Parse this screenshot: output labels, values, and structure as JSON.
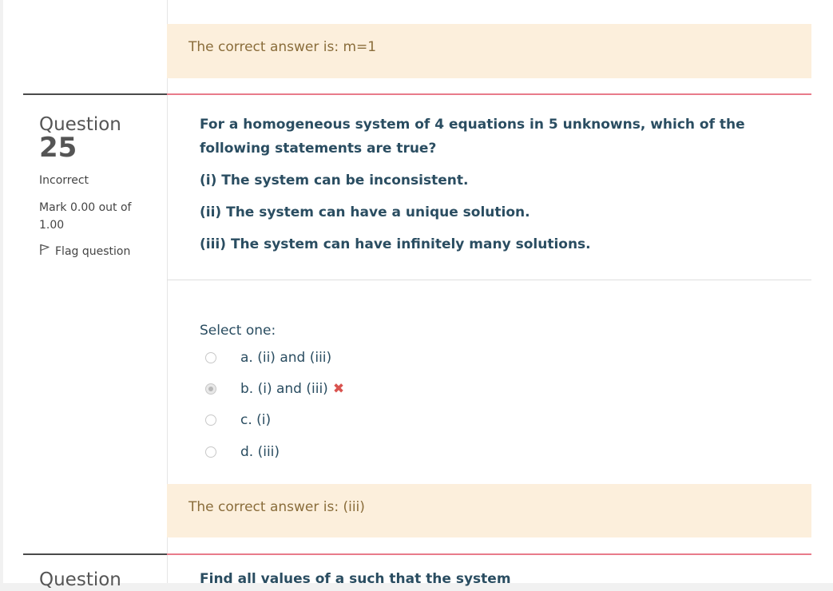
{
  "prev_feedback": {
    "text": "The correct answer is: m=1"
  },
  "question": {
    "label": "Question",
    "number": "25",
    "state": "Incorrect",
    "grade": "Mark 0.00 out of 1.00",
    "flag_label": "Flag question",
    "text_main": "For a homogeneous system of 4 equations in 5 unknowns, which of the following statements are true?",
    "stmt_1": "(i) The system can be inconsistent.",
    "stmt_2": "(ii) The system can have a unique solution.",
    "stmt_3": "(iii) The system can have infinitely many solutions.",
    "prompt": "Select one:",
    "options": [
      {
        "label": "a. (ii) and (iii)",
        "selected": false
      },
      {
        "label": "b. (i) and (iii)",
        "selected": true,
        "marked_incorrect": true
      },
      {
        "label": "c. (i)",
        "selected": false
      },
      {
        "label": "d. (iii)",
        "selected": false
      }
    ],
    "feedback": "The correct answer is: (iii)"
  },
  "next_question": {
    "label": "Question",
    "text": "Find all values of a such that the system"
  },
  "colors": {
    "feedback_bg": "#fcefdc",
    "feedback_text": "#8a6d3b",
    "question_text": "#2a4d61",
    "incorrect": "#d9534f",
    "accent_rule": "#e87b8a"
  }
}
